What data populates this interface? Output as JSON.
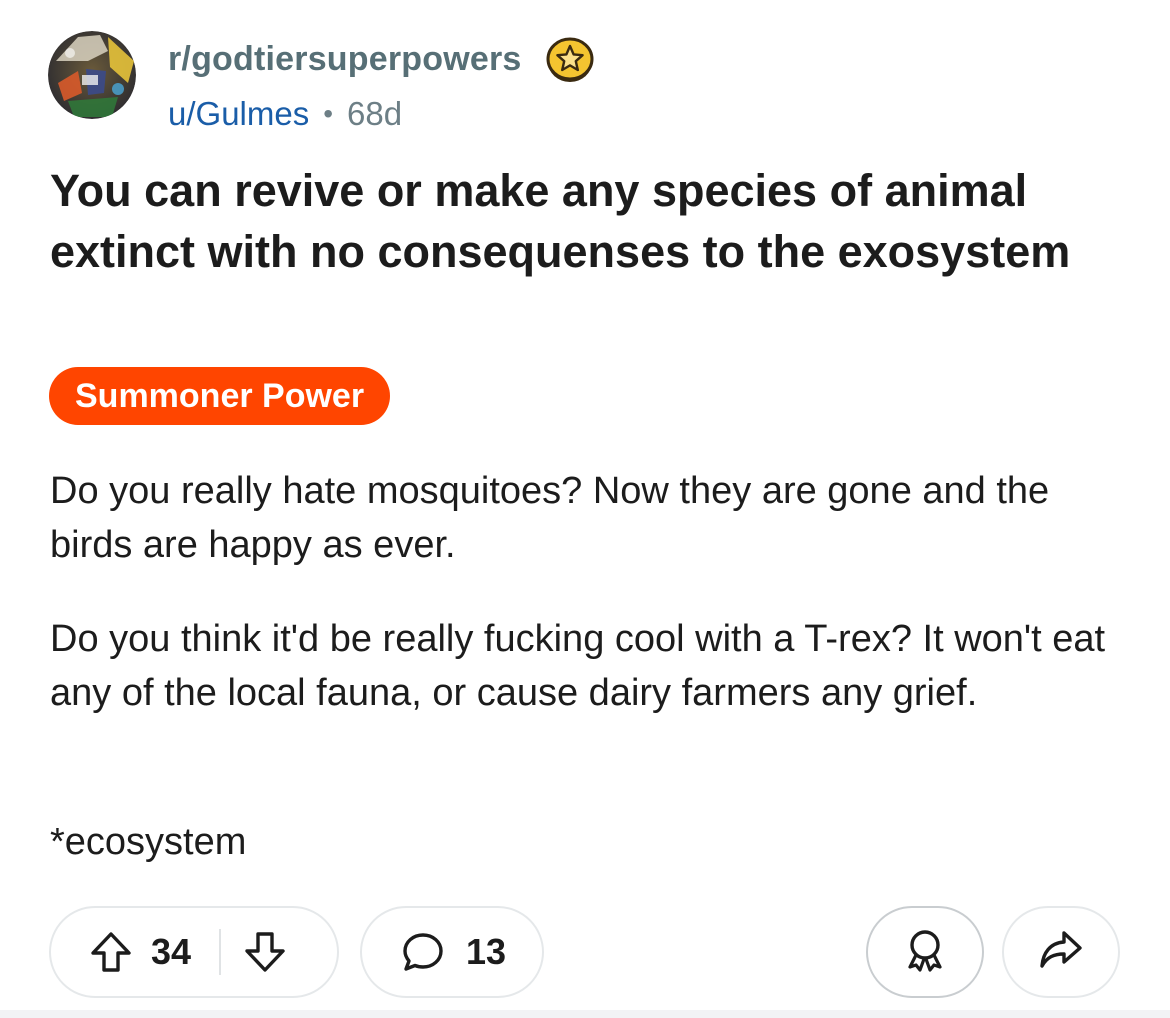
{
  "post": {
    "subreddit": "r/godtiersuperpowers",
    "username": "u/Gulmes",
    "separator": "•",
    "age": "68d",
    "title": "You can revive or make any species of animal extinct with no consequenses to the exosystem",
    "flair": "Summoner Power",
    "paragraphs": [
      "Do you really hate mosquitoes? Now they are gone and the birds are happy as ever.",
      "Do you think it'd be really fucking cool with a T-rex? It won't eat any of the local fauna, or cause dairy farmers any grief.",
      "*ecosystem"
    ]
  },
  "actions": {
    "score": "34",
    "comments": "13"
  },
  "icons": {
    "avatar": "subreddit-avatar",
    "coin": "star-coin-icon",
    "upvote": "upvote-arrow-icon",
    "downvote": "downvote-arrow-icon",
    "comment": "comment-bubble-icon",
    "award": "award-ribbon-icon",
    "share": "share-arrow-icon"
  },
  "colors": {
    "flair_bg": "#ff4500",
    "subreddit_text": "#576f76",
    "username_text": "#1a5da8",
    "muted_text": "#6d7f86",
    "coin_gold": "#f4c430"
  }
}
